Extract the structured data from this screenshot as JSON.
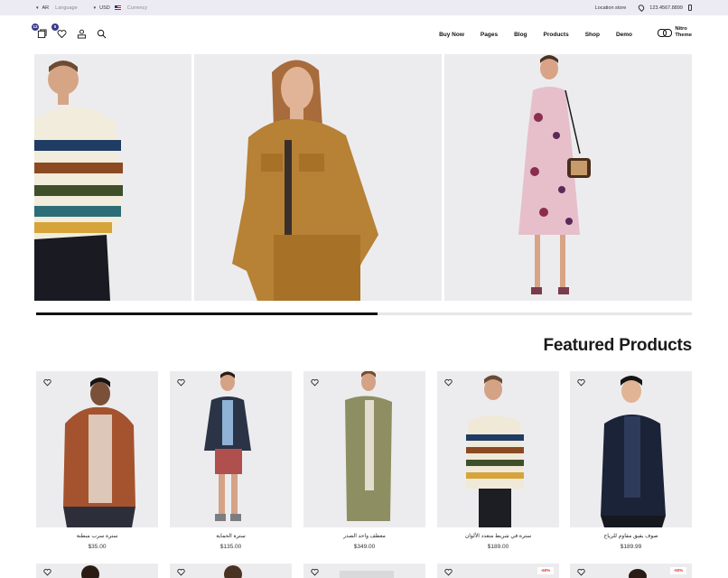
{
  "topbar": {
    "language_code": "AR",
    "language_label": "Language",
    "currency_code": "USD",
    "currency_label": "Currency",
    "location": "Location store",
    "phone": "123.4567.8899"
  },
  "header": {
    "compare_count": "12",
    "wishlist_count": "0",
    "nav": [
      "Buy Now",
      "Pages",
      "Blog",
      "Products",
      "Shop",
      "Demo"
    ],
    "logo_line1": "Nitro",
    "logo_line2": "Theme"
  },
  "hero": {
    "progress": 0.52
  },
  "featured": {
    "title": "Featured Products",
    "products": [
      {
        "name": "سترة سرب مبطنة",
        "price": "$35.00"
      },
      {
        "name": "سترة الحماية",
        "price": "$135.00"
      },
      {
        "name": "معطف واحد الصدر",
        "price": "$349.00"
      },
      {
        "name": "سترة في شريط متعدد الألوان",
        "price": "$189.00"
      },
      {
        "name": "صوف يقيق مقاوم للرياح",
        "price": "$189.99"
      }
    ],
    "row2_sale_badges": [
      "-60%",
      "-50%"
    ]
  },
  "colors": {
    "topbar_bg": "#ecebf3",
    "badge": "#3a3a8c",
    "image_bg": "#ececee",
    "sale_text": "#d23a3a"
  }
}
